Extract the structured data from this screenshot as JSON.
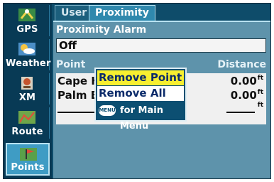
{
  "sidebar": {
    "items": [
      {
        "label": "GPS",
        "icon": "satellite-icon"
      },
      {
        "label": "Weather",
        "icon": "weather-icon"
      },
      {
        "label": "XM",
        "icon": "xm-radio-icon"
      },
      {
        "label": "Route",
        "icon": "route-map-icon"
      },
      {
        "label": "Points",
        "icon": "points-flag-icon",
        "active": true
      }
    ]
  },
  "tabs": [
    {
      "label": "User"
    },
    {
      "label": "Proximity",
      "active": true
    }
  ],
  "proximity": {
    "alarm_label": "Proximity Alarm",
    "alarm_value": "Off"
  },
  "list": {
    "col_point": "Point",
    "col_distance": "Distance",
    "rows": [
      {
        "name": "Cape H",
        "distance": "0.00",
        "unit": "ft"
      },
      {
        "name": "Palm B",
        "distance": "0.00",
        "unit": "ft"
      }
    ],
    "empty_unit": "ft"
  },
  "popup": {
    "items": [
      "Remove Point",
      "Remove All"
    ],
    "footer_button": "MENU",
    "footer_text": "for Main Menu"
  },
  "colors": {
    "highlight": "#f7ef30",
    "panel": "#5e93ab",
    "sidebar": "#083a55"
  }
}
